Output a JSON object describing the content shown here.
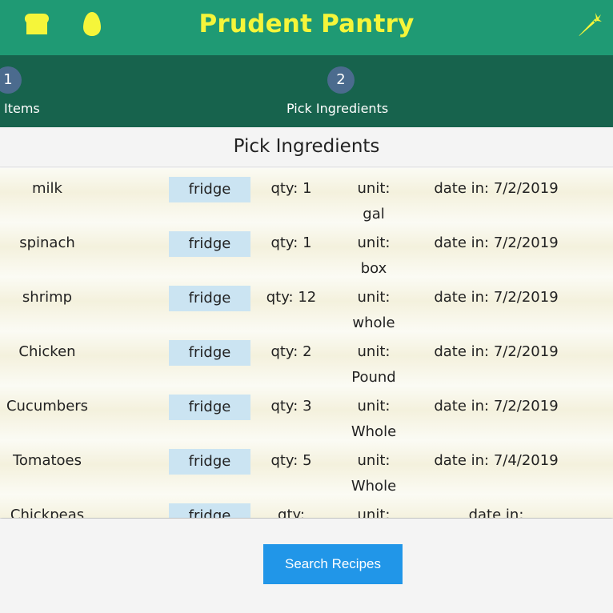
{
  "app": {
    "title": "Prudent Pantry",
    "icons": [
      "bread-icon",
      "egg-icon",
      "carrot-icon"
    ],
    "colors": {
      "header": "#1f9a74",
      "stepper": "#17634d",
      "title": "#f5f53a",
      "button": "#2196e8"
    }
  },
  "stepper": {
    "steps": [
      {
        "number": "1",
        "label": "Items"
      },
      {
        "number": "2",
        "label": "Pick Ingredients"
      }
    ]
  },
  "section": {
    "title": "Pick Ingredients"
  },
  "items": [
    {
      "name": "milk",
      "location": "fridge",
      "qty": "qty: 1",
      "unit_label": "unit:",
      "unit": "gal",
      "date": "date in: 7/2/2019"
    },
    {
      "name": "spinach",
      "location": "fridge",
      "qty": "qty: 1",
      "unit_label": "unit:",
      "unit": "box",
      "date": "date in: 7/2/2019"
    },
    {
      "name": "shrimp",
      "location": "fridge",
      "qty": "qty: 12",
      "unit_label": "unit:",
      "unit": "whole",
      "date": "date in: 7/2/2019"
    },
    {
      "name": "Chicken",
      "location": "fridge",
      "qty": "qty: 2",
      "unit_label": "unit:",
      "unit": "Pound",
      "date": "date in: 7/2/2019"
    },
    {
      "name": "Cucumbers",
      "location": "fridge",
      "qty": "qty: 3",
      "unit_label": "unit:",
      "unit": "Whole",
      "date": "date in: 7/2/2019"
    },
    {
      "name": "Tomatoes",
      "location": "fridge",
      "qty": "qty: 5",
      "unit_label": "unit:",
      "unit": "Whole",
      "date": "date in: 7/4/2019"
    },
    {
      "name": "Chickpeas",
      "location": "fridge",
      "qty": "qty:",
      "unit_label": "unit:",
      "unit": "",
      "date": "date in:"
    }
  ],
  "footer": {
    "search_label": "Search Recipes"
  }
}
